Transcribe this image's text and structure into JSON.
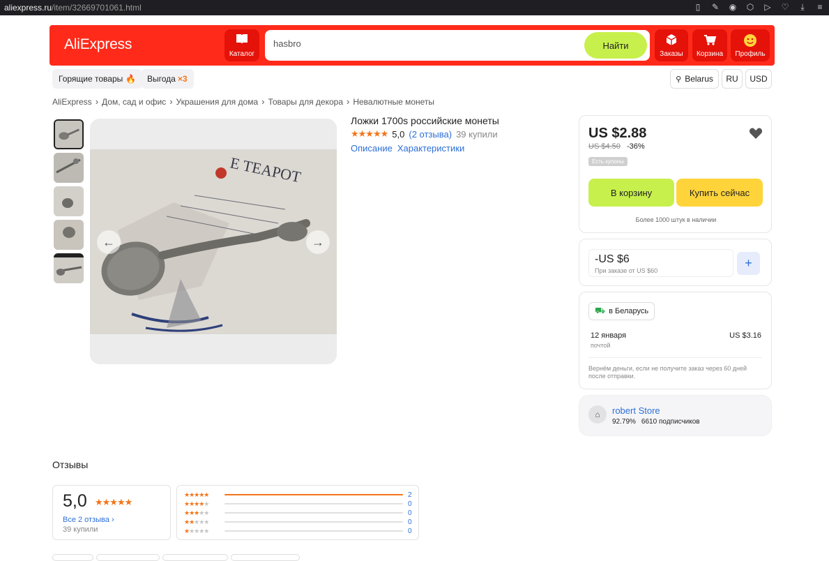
{
  "browser": {
    "url_host": "aliexpress.ru",
    "url_path": "/item/32669701061.html"
  },
  "header": {
    "logo": "AliExpress",
    "catalog": "Каталог",
    "search_value": "hasbro",
    "search_button": "Найти",
    "orders": "Заказы",
    "cart": "Корзина",
    "profile": "Профиль"
  },
  "subnav": {
    "hot": "Горящие товары",
    "benefit": "Выгода",
    "benefit_badge": "×3",
    "region": "Belarus",
    "lang": "RU",
    "currency": "USD"
  },
  "breadcrumb": [
    "AliExpress",
    "Дом, сад и офис",
    "Украшения для дома",
    "Товары для декора",
    "Невалютные монеты"
  ],
  "product": {
    "title": "Ложки 1700s российские монеты",
    "stars": "★★★★★",
    "rating": "5,0",
    "reviews_link": "(2 отзыва)",
    "bought": "39 купили",
    "tab_description": "Описание",
    "tab_specs": "Характеристики"
  },
  "buy_card": {
    "price": "US $2.88",
    "old_price": "US $4.50",
    "discount": "-36%",
    "coupons": "Есть купоны",
    "add_to_cart": "В корзину",
    "buy_now": "Купить сейчас",
    "stock": "Более 1000 штук в наличии"
  },
  "coupon_card": {
    "amount": "-US $6",
    "condition": "При заказе от US $60",
    "add": "+"
  },
  "delivery_card": {
    "destination": "в Беларусь",
    "date": "12 января",
    "method": "почтой",
    "cost": "US $3.16",
    "guarantee": "Вернём деньги, если не получите заказ через 60 дней после отправки."
  },
  "store": {
    "name": "robert Store",
    "positive": "92.79%",
    "followers": "6610 подписчиков"
  },
  "reviews": {
    "title": "Отзывы",
    "score": "5,0",
    "stars": "★★★★★",
    "all_link": "Все 2 отзыва",
    "bought": "39 купили",
    "breakdown": [
      {
        "stars": 5,
        "count": "2",
        "fraction": 1.0
      },
      {
        "stars": 4,
        "count": "0",
        "fraction": 0
      },
      {
        "stars": 3,
        "count": "0",
        "fraction": 0
      },
      {
        "stars": 2,
        "count": "0",
        "fraction": 0
      },
      {
        "stars": 1,
        "count": "0",
        "fraction": 0
      }
    ]
  },
  "colors": {
    "brand_red": "#ff2a1a",
    "accent_green": "#c8f04c",
    "accent_yellow": "#ffd43a",
    "star_orange": "#f57418",
    "link_blue": "#2d6fd8"
  }
}
